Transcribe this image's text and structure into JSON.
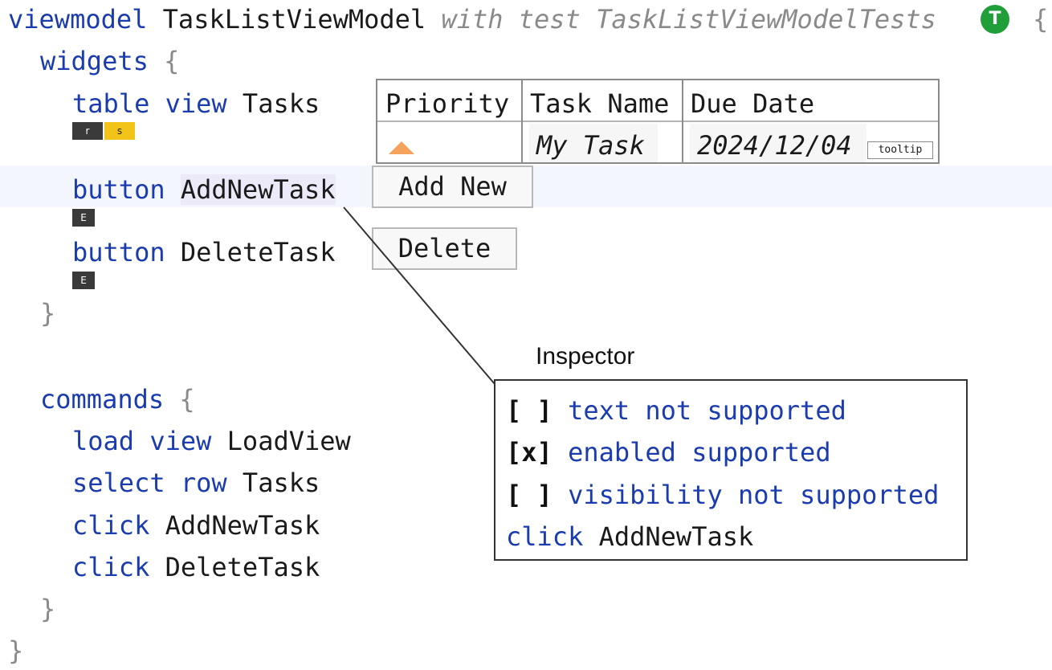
{
  "header": {
    "keyword": "viewmodel",
    "name": "TaskListViewModel",
    "with_text": "with test TaskListViewModelTests",
    "test_icon_letter": "T",
    "open_brace": "{"
  },
  "widgets": {
    "keyword": "widgets",
    "open_brace": "{",
    "close_brace": "}",
    "table": {
      "kw1": "table",
      "kw2": "view",
      "name": "Tasks",
      "badges": [
        "r",
        "s"
      ],
      "columns": [
        "Priority",
        "Task Name",
        "Due Date"
      ],
      "row": {
        "priority_icon": "up-arrow-icon",
        "task_name": "My Task",
        "due_date": "2024/12/04",
        "tooltip_label": "tooltip"
      }
    },
    "add_button": {
      "keyword": "button",
      "name": "AddNewTask",
      "badge": "E",
      "preview_label": "Add New"
    },
    "delete_button": {
      "keyword": "button",
      "name": "DeleteTask",
      "badge": "E",
      "preview_label": "Delete"
    }
  },
  "commands": {
    "keyword": "commands",
    "open_brace": "{",
    "close_brace": "}",
    "items": [
      {
        "kw": "load view",
        "target": "LoadView"
      },
      {
        "kw": "select row",
        "target": "Tasks"
      },
      {
        "kw": "click",
        "target": "AddNewTask"
      },
      {
        "kw": "click",
        "target": "DeleteTask"
      }
    ]
  },
  "final_brace": "}",
  "inspector": {
    "title": "Inspector",
    "lines": [
      {
        "mark": "[ ]",
        "text": "text not supported"
      },
      {
        "mark": "[x]",
        "text": "enabled supported"
      },
      {
        "mark": "[ ]",
        "text": "visibility not supported"
      }
    ],
    "action_kw": "click",
    "action_target": "AddNewTask"
  },
  "colors": {
    "keyword": "#1a3caf",
    "brace": "#8a8a8a",
    "badge_dark": "#3a3a3a",
    "badge_yellow": "#f2c318",
    "test_icon": "#1f9e3a",
    "priority_arrow": "#f5a25d"
  }
}
